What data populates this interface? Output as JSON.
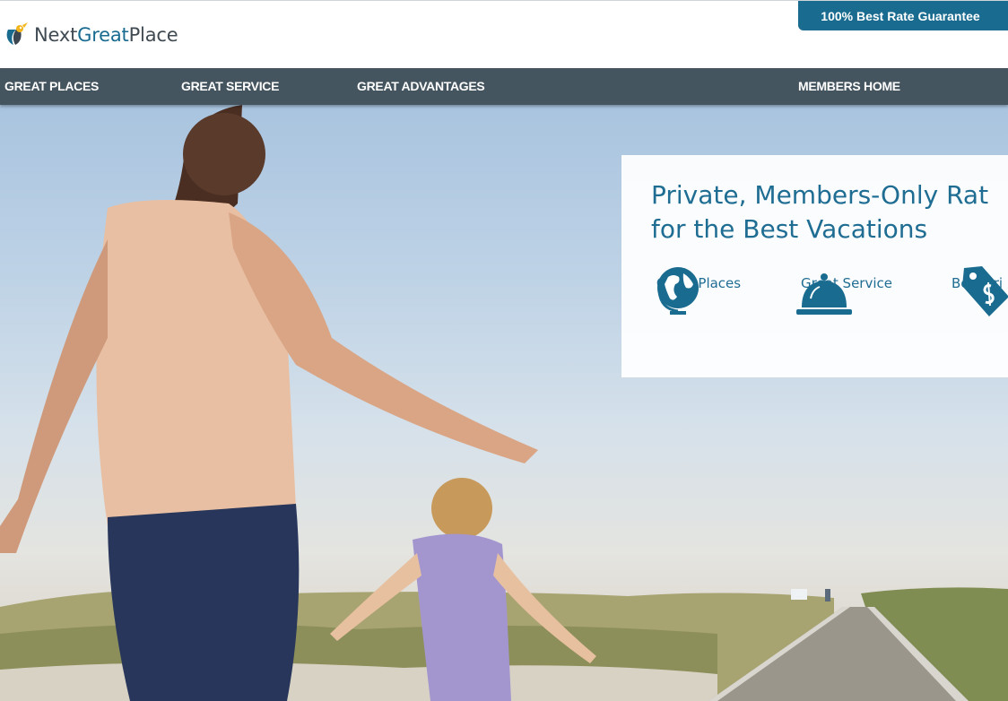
{
  "brand": {
    "name_part1": "Next",
    "name_part2": "Great",
    "name_part3": "Place",
    "badge": "100% Best Rate Guarantee"
  },
  "nav": {
    "items": [
      {
        "label": "GREAT PLACES"
      },
      {
        "label": "GREAT SERVICE"
      },
      {
        "label": "GREAT ADVANTAGES"
      },
      {
        "label": "MEMBERS HOME"
      }
    ]
  },
  "promo": {
    "headline_line1": "Private, Members-Only Rat",
    "headline_line2": "for the Best Vacations",
    "features": [
      {
        "label": "Great Places",
        "icon": "globe-icon"
      },
      {
        "label": "Great Service",
        "icon": "service-bell-icon"
      },
      {
        "label": "Best Pri",
        "icon": "price-tag-icon"
      }
    ]
  },
  "colors": {
    "brand_blue": "#196b8f",
    "nav_bg": "#45555f",
    "promo_text": "#1f6d93"
  }
}
